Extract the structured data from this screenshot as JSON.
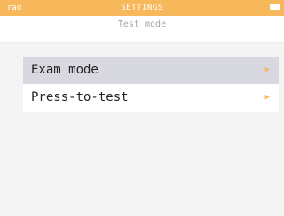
{
  "status_bar": {
    "left_label": "rad",
    "title": "SETTINGS",
    "background_color": "#f6b85a",
    "battery_icon": "battery-icon"
  },
  "subtitle": "Test mode",
  "menu": {
    "items": [
      {
        "label": "Exam mode",
        "selected": true,
        "icon": "chevron-right-icon"
      },
      {
        "label": "Press-to-test",
        "selected": false,
        "icon": "chevron-right-icon"
      }
    ],
    "chevron_glyph": "▶",
    "accent_color": "#f6b85a",
    "selected_bg": "#d8d8e0"
  }
}
